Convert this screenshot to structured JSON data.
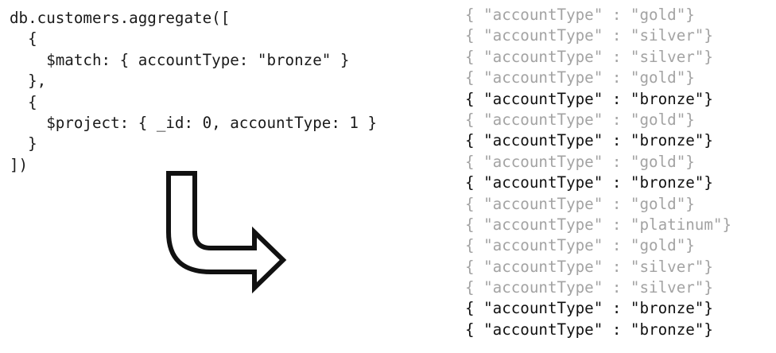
{
  "code_lines": [
    "db.customers.aggregate([",
    "  {",
    "    $match: { accountType: \"bronze\" }",
    "  },",
    "  {",
    "    $project: { _id: 0, accountType: 1 }",
    "  }",
    "])"
  ],
  "arrow_icon": "curved-down-right-arrow-icon",
  "documents": [
    {
      "text": "{ \"accountType\" : \"gold\"}",
      "matched": false
    },
    {
      "text": "{ \"accountType\" : \"silver\"}",
      "matched": false
    },
    {
      "text": "{ \"accountType\" : \"silver\"}",
      "matched": false
    },
    {
      "text": "{ \"accountType\" : \"gold\"}",
      "matched": false
    },
    {
      "text": "{ \"accountType\" : \"bronze\"}",
      "matched": true
    },
    {
      "text": "{ \"accountType\" : \"gold\"}",
      "matched": false
    },
    {
      "text": "{ \"accountType\" : \"bronze\"}",
      "matched": true
    },
    {
      "text": "{ \"accountType\" : \"gold\"}",
      "matched": false
    },
    {
      "text": "{ \"accountType\" : \"bronze\"}",
      "matched": true
    },
    {
      "text": "{ \"accountType\" : \"gold\"}",
      "matched": false
    },
    {
      "text": "{ \"accountType\" : \"platinum\"}",
      "matched": false
    },
    {
      "text": "{ \"accountType\" : \"gold\"}",
      "matched": false
    },
    {
      "text": "{ \"accountType\" : \"silver\"}",
      "matched": false
    },
    {
      "text": "{ \"accountType\" : \"silver\"}",
      "matched": false
    },
    {
      "text": "{ \"accountType\" : \"bronze\"}",
      "matched": true
    },
    {
      "text": "{ \"accountType\" : \"bronze\"}",
      "matched": true
    }
  ],
  "colors": {
    "matched_text": "#111111",
    "unmatched_text": "#a3a3a3",
    "code_text": "#1a1a1a"
  }
}
